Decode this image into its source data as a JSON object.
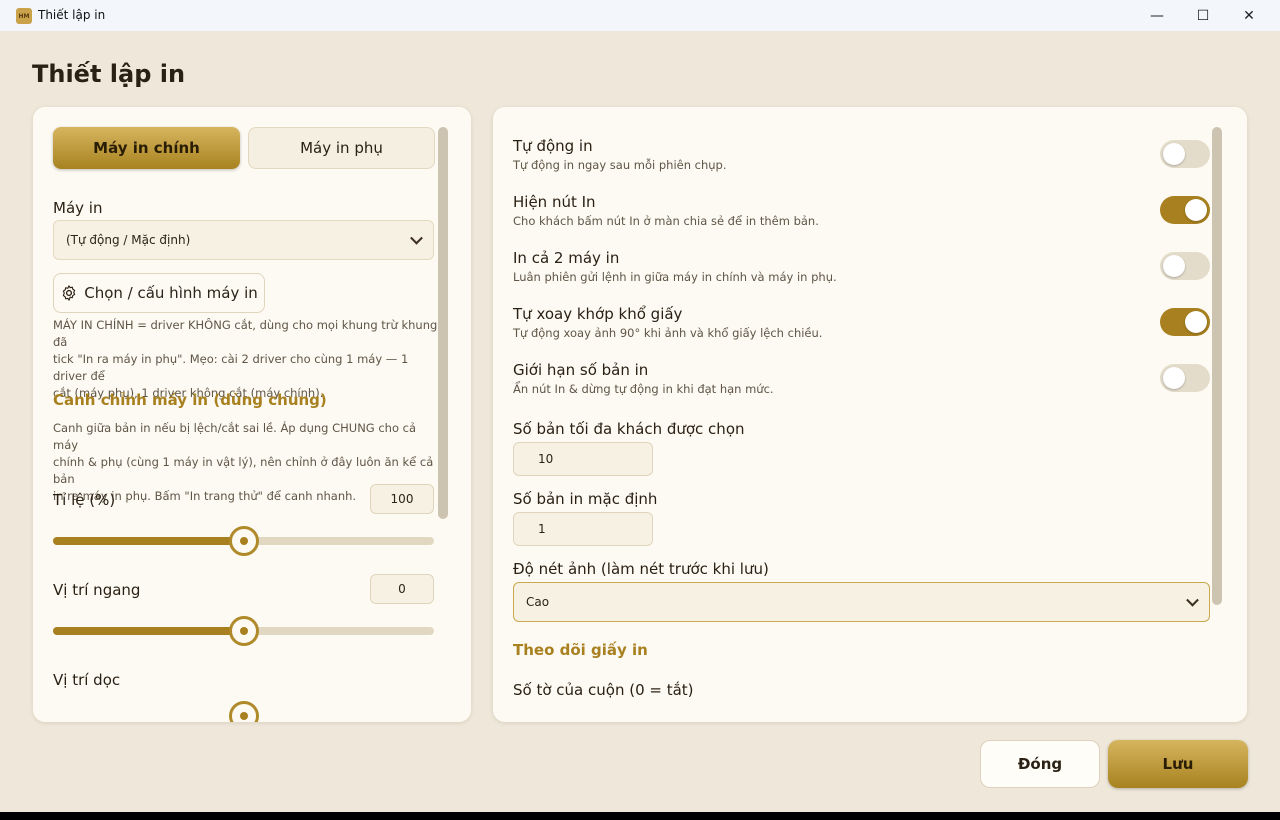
{
  "window": {
    "app_icon_text": "HM",
    "title": "Thiết lập in",
    "minimize_glyph": "—",
    "maximize_glyph": "☐",
    "close_glyph": "✕"
  },
  "page": {
    "title": "Thiết lập in"
  },
  "left": {
    "tabs": [
      {
        "label": "Máy in chính",
        "active": true
      },
      {
        "label": "Máy in phụ",
        "active": false
      }
    ],
    "printer_label": "Máy in",
    "printer_select_value": "(Tự động / Mặc định)",
    "configure_button": "Chọn / cấu hình máy in",
    "printer_note_1": "MÁY IN CHÍNH = driver KHÔNG cắt, dùng cho mọi khung trừ khung đã",
    "printer_note_2": "tick \"In ra máy in phụ\". Mẹo: cài 2 driver cho cùng 1 máy — 1 driver để",
    "printer_note_3": "cắt (máy phụ), 1 driver không cắt (máy chính).",
    "alignment_title": "Canh chỉnh máy in (dùng chung)",
    "alignment_note_1": "Canh giữa bản in nếu bị lệch/cắt sai lề. Áp dụng CHUNG cho cả máy",
    "alignment_note_2": "chính & phụ (cùng 1 máy in vật lý), nên chỉnh ở đây luôn ăn kể cả bản",
    "alignment_note_3": "in ra máy in phụ. Bấm \"In trang thử\" để canh nhanh.",
    "scale": {
      "label": "Tỉ lệ (%)",
      "value": "100",
      "slider_fraction": 0.5
    },
    "horizontal": {
      "label": "Vị trí ngang",
      "value": "0",
      "slider_fraction": 0.5
    },
    "vertical": {
      "label": "Vị trí dọc"
    }
  },
  "right": {
    "toggles": [
      {
        "title": "Tự động in",
        "desc": "Tự động in ngay sau mỗi phiên chụp.",
        "on": false
      },
      {
        "title": "Hiện nút In",
        "desc": "Cho khách bấm nút In ở màn chia sẻ để in thêm bản.",
        "on": true
      },
      {
        "title": "In cả 2 máy in",
        "desc": "Luân phiên gửi lệnh in giữa máy in chính và máy in phụ.",
        "on": false
      },
      {
        "title": "Tự xoay khớp khổ giấy",
        "desc": "Tự động xoay ảnh 90° khi ảnh và khổ giấy lệch chiều.",
        "on": true
      },
      {
        "title": "Giới hạn số bản in",
        "desc": "Ẩn nút In & dừng tự động in khi đạt hạn mức.",
        "on": false
      }
    ],
    "max_copies_label": "Số bản tối đa khách được chọn",
    "max_copies_value": "10",
    "default_copies_label": "Số bản in mặc định",
    "default_copies_value": "1",
    "sharpness_label": "Độ nét ảnh (làm nét trước khi lưu)",
    "sharpness_value": "Cao",
    "paper_section_title": "Theo dõi giấy in",
    "roll_sheets_label": "Số tờ của cuộn (0 = tắt)"
  },
  "footer": {
    "close_label": "Đóng",
    "save_label": "Lưu"
  },
  "colors": {
    "accent": "#a8801f",
    "background": "#efe8da",
    "card": "#fdfaf3"
  }
}
